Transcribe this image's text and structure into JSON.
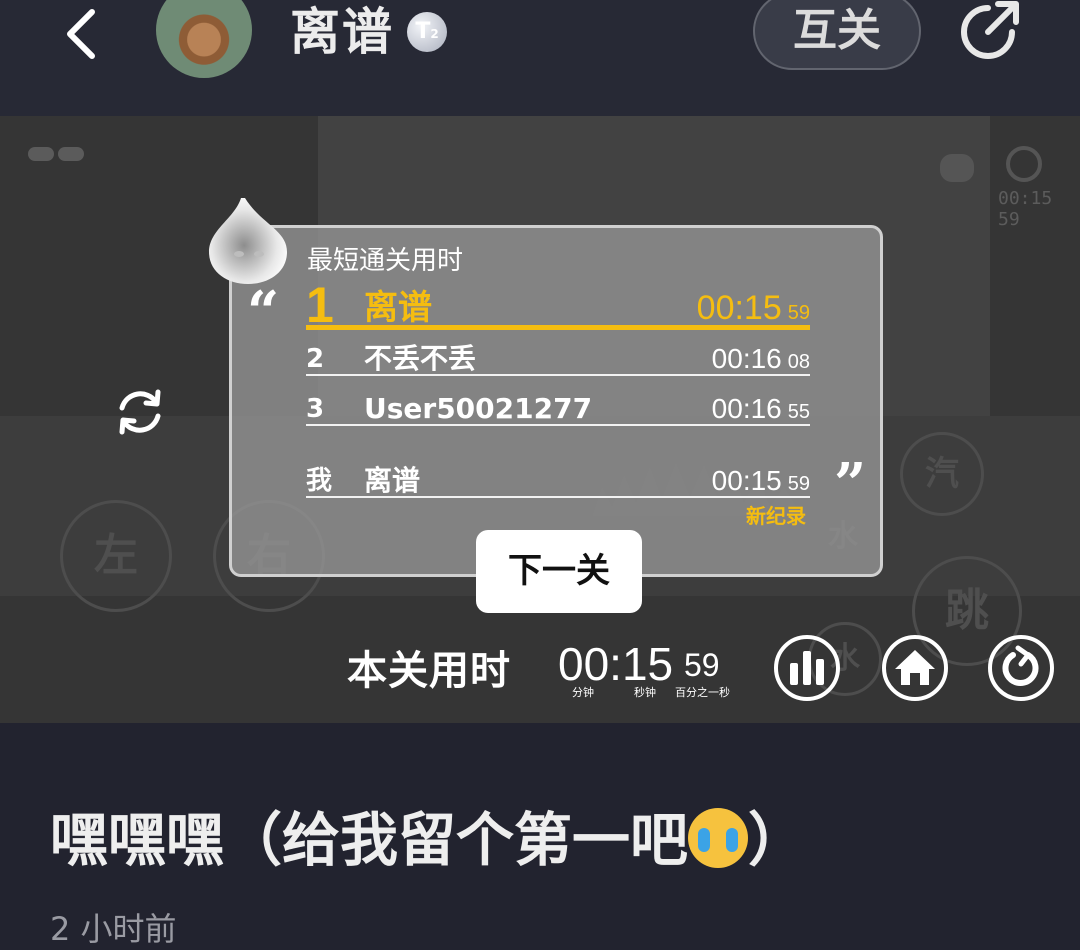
{
  "header": {
    "username": "离谱",
    "level": "T",
    "level_sub": "2",
    "follow_label": "互关"
  },
  "game": {
    "hud_time": "00:15 59",
    "controls": {
      "left": "左",
      "right": "右",
      "steam": "汽",
      "water": "水",
      "jump": "跳",
      "water2": "水"
    },
    "leaderboard": {
      "title": "最短通关用时",
      "rows": [
        {
          "rank": "1",
          "name": "离谱",
          "time": "00:15",
          "cs": "59"
        },
        {
          "rank": "2",
          "name": "不丢不丢",
          "time": "00:16",
          "cs": "08"
        },
        {
          "rank": "3",
          "name": "User50021277",
          "time": "00:16",
          "cs": "55"
        }
      ],
      "me": {
        "rank": "我",
        "name": "离谱",
        "time": "00:15",
        "cs": "59"
      },
      "new_record": "新纪录"
    },
    "next_button": "下一关",
    "level_time": {
      "label": "本关用时",
      "main": "00:15",
      "centis": "59",
      "unit_min": "分钟",
      "unit_sec": "秒钟",
      "unit_cs": "百分之一秒"
    }
  },
  "post": {
    "caption": "嘿嘿嘿（给我留个第一吧",
    "caption_end": "）",
    "posted": "2 小时前"
  },
  "colors": {
    "accent_gold": "#f5bd10",
    "header_bg": "#272935",
    "page_bg": "#22232f"
  },
  "icons": [
    "back-chevron-icon",
    "share-icon",
    "reset-icon",
    "leaderboard-stats-icon",
    "home-icon",
    "retry-icon",
    "crying-emoji-icon"
  ]
}
